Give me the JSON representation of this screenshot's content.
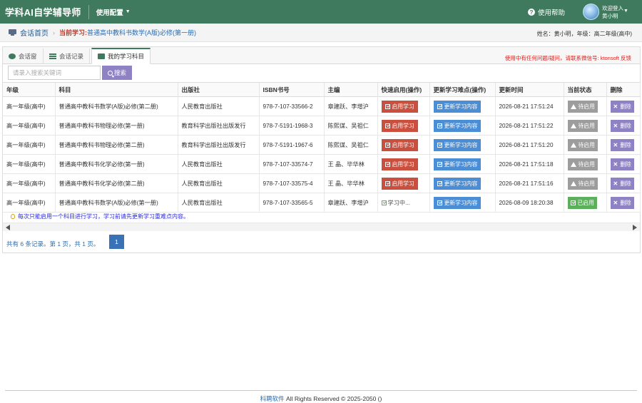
{
  "header": {
    "brand": "学科AI自学辅导师",
    "config_menu": "使用配置",
    "help": "使用帮助",
    "welcome": "欢迎登入",
    "username": "黄小明"
  },
  "breadcrumb": {
    "home": "会话首页",
    "current_label": "当前学习:",
    "current_value": "普通高中教科书数学(A版)必修(第一册)",
    "student_info": "姓名：黄小明，年级：高二年级(高中)"
  },
  "tabs": [
    {
      "label": "会话窗",
      "icon": "chat-icon"
    },
    {
      "label": "会话记录",
      "icon": "list-icon"
    },
    {
      "label": "我的学习科目",
      "icon": "book-icon",
      "active": true
    }
  ],
  "notice": "使用中有任何问题/疑问，请联系微信号: ktonsoft 反馈",
  "search": {
    "placeholder": "请录入搜索关键词",
    "button": "搜索"
  },
  "table": {
    "headers": [
      "年级",
      "科目",
      "出版社",
      "ISBN书号",
      "主编",
      "快速启用(操作)",
      "更新学习难点(操作)",
      "更新时间",
      "当前状态",
      "删除"
    ],
    "rows": [
      {
        "grade": "高一年级(高中)",
        "subject": "普通高中教科书数学(A版)必修(第二册)",
        "publisher": "人民教育出版社",
        "isbn": "978-7-107-33566-2",
        "editor": "章建跃、李增沪",
        "action": "启用学习",
        "update": "更新学习内容",
        "time": "2026-08-21 17:51:24",
        "status": "待启用",
        "delete": "删除"
      },
      {
        "grade": "高一年级(高中)",
        "subject": "普通高中教科书物理必修(第一册)",
        "publisher": "教育科学出版社出版发行",
        "isbn": "978-7-5191-1968-3",
        "editor": "陈熙谋、吴祖仁",
        "action": "启用学习",
        "update": "更新学习内容",
        "time": "2026-08-21 17:51:22",
        "status": "待启用",
        "delete": "删除"
      },
      {
        "grade": "高一年级(高中)",
        "subject": "普通高中教科书物理必修(第二册)",
        "publisher": "教育科学出版社出版发行",
        "isbn": "978-7-5191-1967-6",
        "editor": "陈熙谋、吴祖仁",
        "action": "启用学习",
        "update": "更新学习内容",
        "time": "2026-08-21 17:51:20",
        "status": "待启用",
        "delete": "删除"
      },
      {
        "grade": "高一年级(高中)",
        "subject": "普通高中教科书化学必修(第一册)",
        "publisher": "人民教育出版社",
        "isbn": "978-7-107-33574-7",
        "editor": "王 晶、毕华林",
        "action": "启用学习",
        "update": "更新学习内容",
        "time": "2026-08-21 17:51:18",
        "status": "待启用",
        "delete": "删除"
      },
      {
        "grade": "高一年级(高中)",
        "subject": "普通高中教科书化学必修(第二册)",
        "publisher": "人民教育出版社",
        "isbn": "978-7-107-33575-4",
        "editor": "王 晶、毕华林",
        "action": "启用学习",
        "update": "更新学习内容",
        "time": "2026-08-21 17:51:16",
        "status": "待启用",
        "delete": "删除"
      },
      {
        "grade": "高一年级(高中)",
        "subject": "普通高中教科书数学(A版)必修(第一册)",
        "publisher": "人民教育出版社",
        "isbn": "978-7-107-33565-5",
        "editor": "章建跃、李增沪",
        "action": "学习中...",
        "update": "更新学习内容",
        "time": "2026-08-09 18:20:38",
        "status": "已启用",
        "delete": "删除"
      }
    ]
  },
  "tip": "每次只能启用一个科目进行学习，学习前请先更新学习重难点内容。",
  "pagination": {
    "summary": "共有 6 条记录。第 1 页，共 1 页。",
    "current_page": "1"
  },
  "footer": {
    "link": "科聘软件",
    "text": " All Rights Reserved © 2025-2050 ()"
  },
  "colors": {
    "topbar": "#3f7a5e",
    "start_button": "#c9503f",
    "update_button": "#4c8ed6",
    "pending_status": "#9d9d9d",
    "active_status": "#5cb05c",
    "delete_button": "#8f82c4"
  }
}
